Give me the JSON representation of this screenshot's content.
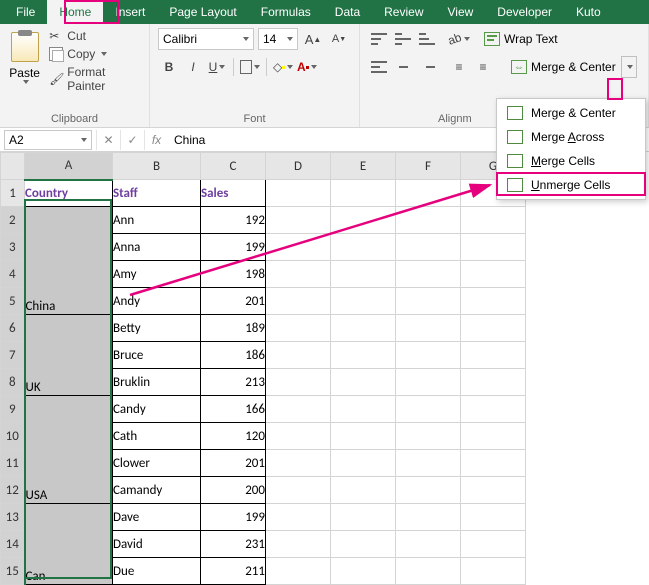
{
  "tabs": {
    "file": "File",
    "home": "Home",
    "insert": "Insert",
    "page_layout": "Page Layout",
    "formulas": "Formulas",
    "data": "Data",
    "review": "Review",
    "view": "View",
    "developer": "Developer",
    "kutools": "Kuto"
  },
  "clipboard": {
    "paste": "Paste",
    "cut": "Cut",
    "copy": "Copy",
    "format_painter": "Format Painter",
    "group_label": "Clipboard"
  },
  "font": {
    "name": "Calibri",
    "size": "14",
    "group_label": "Font"
  },
  "alignment": {
    "wrap_text": "Wrap Text",
    "merge_center": "Merge & Center",
    "group_label": "Alignm"
  },
  "merge_menu": {
    "merge_center": "Merge & Center",
    "merge_across": "Merge Across",
    "merge_cells": "Merge Cells",
    "unmerge": "Unmerge Cells"
  },
  "formula_bar": {
    "name_box": "A2",
    "fx": "fx",
    "value": "China"
  },
  "columns": [
    "A",
    "B",
    "C",
    "D",
    "E",
    "F",
    "G"
  ],
  "headers": {
    "a": "Country",
    "b": "Staff",
    "c": "Sales"
  },
  "rows": [
    {
      "n": 2,
      "staff": "Ann",
      "sales": 192
    },
    {
      "n": 3,
      "staff": "Anna",
      "sales": 199
    },
    {
      "n": 4,
      "staff": "Amy",
      "sales": 198
    },
    {
      "n": 5,
      "staff": "Andy",
      "sales": 201
    },
    {
      "n": 6,
      "staff": "Betty",
      "sales": 189
    },
    {
      "n": 7,
      "staff": "Bruce",
      "sales": 186
    },
    {
      "n": 8,
      "staff": "Bruklin",
      "sales": 213
    },
    {
      "n": 9,
      "staff": "Candy",
      "sales": 166
    },
    {
      "n": 10,
      "staff": "Cath",
      "sales": 120
    },
    {
      "n": 11,
      "staff": "Clower",
      "sales": 201
    },
    {
      "n": 12,
      "staff": "Camandy",
      "sales": 200
    },
    {
      "n": 13,
      "staff": "Dave",
      "sales": 199
    },
    {
      "n": 14,
      "staff": "David",
      "sales": 231
    },
    {
      "n": 15,
      "staff": "Due",
      "sales": 211
    }
  ],
  "countries": {
    "china": "China",
    "uk": "UK",
    "usa": "USA",
    "can": "Can"
  },
  "chart_data": {
    "type": "table",
    "columns": [
      "Country",
      "Staff",
      "Sales"
    ],
    "rows": [
      [
        "China",
        "Ann",
        192
      ],
      [
        "China",
        "Anna",
        199
      ],
      [
        "China",
        "Amy",
        198
      ],
      [
        "China",
        "Andy",
        201
      ],
      [
        "UK",
        "Betty",
        189
      ],
      [
        "UK",
        "Bruce",
        186
      ],
      [
        "UK",
        "Bruklin",
        213
      ],
      [
        "USA",
        "Candy",
        166
      ],
      [
        "USA",
        "Cath",
        120
      ],
      [
        "USA",
        "Clower",
        201
      ],
      [
        "USA",
        "Camandy",
        200
      ],
      [
        "Can",
        "Dave",
        199
      ],
      [
        "Can",
        "David",
        231
      ],
      [
        "Can",
        "Due",
        211
      ]
    ]
  }
}
